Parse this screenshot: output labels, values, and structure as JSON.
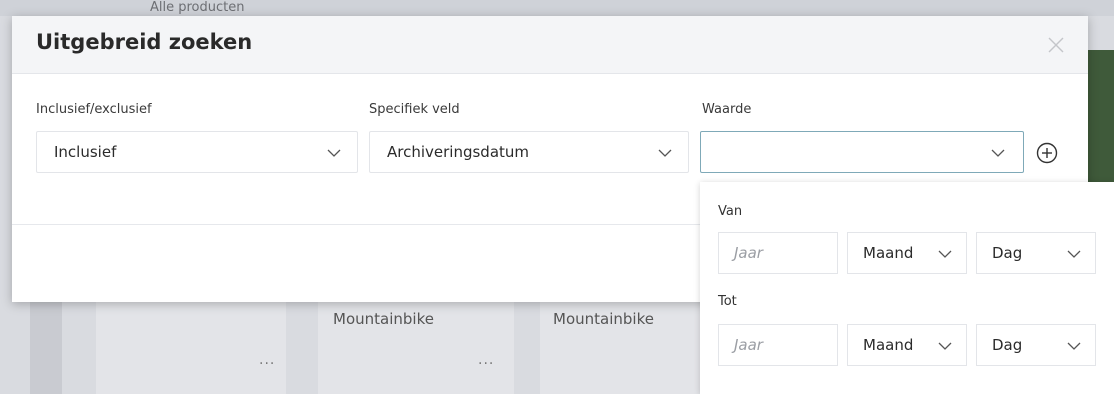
{
  "background": {
    "topbar_text": "Alle producten",
    "cards": [
      {
        "title": "",
        "more": "..."
      },
      {
        "title": "Mountainbike",
        "more": "..."
      },
      {
        "title": "Mountainbike",
        "more": ""
      }
    ]
  },
  "modal": {
    "title": "Uitgebreid zoeken",
    "fields": {
      "inclusion": {
        "label": "Inclusief/exclusief",
        "value": "Inclusief"
      },
      "field": {
        "label": "Specifiek veld",
        "value": "Archiveringsdatum"
      },
      "value": {
        "label": "Waarde",
        "value": ""
      }
    },
    "date_range": {
      "from_label": "Van",
      "to_label": "Tot",
      "year_placeholder": "Jaar",
      "month_label": "Maand",
      "day_label": "Dag"
    }
  },
  "colors": {
    "focus_border": "#7fa9b8",
    "header_bg": "#f4f5f7",
    "overlay": "#d9dbe0"
  },
  "icons": {
    "close": "close-icon",
    "add": "plus-circle-icon",
    "dropdown": "chevron-down-icon"
  }
}
